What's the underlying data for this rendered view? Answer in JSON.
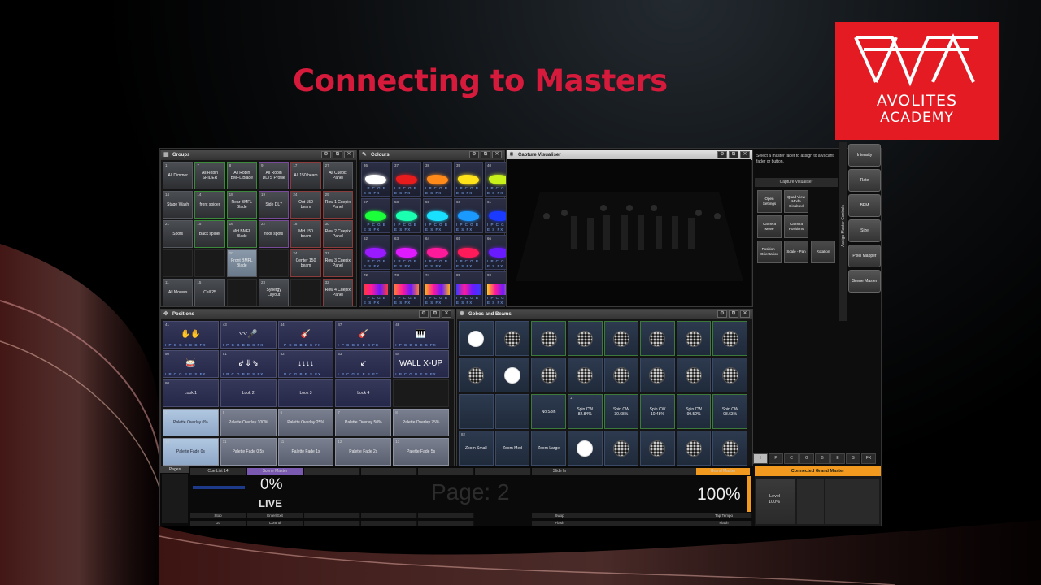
{
  "slide_title": "Connecting to Masters",
  "logo": {
    "line1": "AVOLITES",
    "line2": "ACADEMY",
    "bg_color": "#e51b24"
  },
  "windows": {
    "groups": {
      "title": "Groups",
      "tiles": [
        {
          "num": "1",
          "label": "All Dimmer",
          "cls": ""
        },
        {
          "num": "7",
          "label": "All Robin SPIDER",
          "cls": "g-green"
        },
        {
          "num": "8",
          "label": "All Robin BMFL Blade",
          "cls": "g-green"
        },
        {
          "num": "9",
          "label": "All Robin DL7S Profile",
          "cls": "g-purple"
        },
        {
          "num": "17",
          "label": "All 150 beam",
          "cls": "g-red"
        },
        {
          "num": "27",
          "label": "All Cuepix Panel",
          "cls": ""
        },
        {
          "num": "14",
          "label": "Stage Wash",
          "cls": ""
        },
        {
          "num": "14",
          "label": "front spider",
          "cls": "g-green"
        },
        {
          "num": "18",
          "label": "Rear BMFL Blade",
          "cls": "g-green"
        },
        {
          "num": "19",
          "label": "Side DL7",
          "cls": "g-purple"
        },
        {
          "num": "24",
          "label": "Out 150 beam",
          "cls": "g-red"
        },
        {
          "num": "29",
          "label": "Row 1 Cuepix Panel",
          "cls": "g-red"
        },
        {
          "num": "21",
          "label": "Spots",
          "cls": ""
        },
        {
          "num": "15",
          "label": "Back spider",
          "cls": "g-green"
        },
        {
          "num": "16",
          "label": "Mid BMFL Blade",
          "cls": "g-green"
        },
        {
          "num": "22",
          "label": "floor spots",
          "cls": "g-purple"
        },
        {
          "num": "18",
          "label": "Mid 150 beam",
          "cls": "g-red"
        },
        {
          "num": "30",
          "label": "Row 2 Cuepix Panel",
          "cls": "g-red"
        },
        {
          "num": "",
          "label": "",
          "cls": "empty"
        },
        {
          "num": "",
          "label": "",
          "cls": "empty"
        },
        {
          "num": "20",
          "label": "Front BMFL Blade",
          "cls": "sel"
        },
        {
          "num": "",
          "label": "",
          "cls": "empty"
        },
        {
          "num": "24",
          "label": "Center 150 beam",
          "cls": "g-red"
        },
        {
          "num": "31",
          "label": "Row 3 Cuepix Panel",
          "cls": "g-red"
        },
        {
          "num": "11",
          "label": "All Movers",
          "cls": ""
        },
        {
          "num": "15",
          "label": "Cell 25",
          "cls": ""
        },
        {
          "num": "",
          "label": "",
          "cls": "empty"
        },
        {
          "num": "23",
          "label": "Synergy Layout",
          "cls": ""
        },
        {
          "num": "",
          "label": "",
          "cls": "empty"
        },
        {
          "num": "32",
          "label": "Row 4 Cuepix Panel",
          "cls": "g-red"
        }
      ]
    },
    "colours": {
      "title": "Colours",
      "tiles": [
        {
          "num": "36",
          "color": "#ffffff"
        },
        {
          "num": "37",
          "color": "#e81c1c"
        },
        {
          "num": "38",
          "color": "#ff8a1a"
        },
        {
          "num": "39",
          "color": "#ffe21a"
        },
        {
          "num": "40",
          "color": "#c8f01a"
        },
        {
          "num": "57",
          "color": "#1aff3a"
        },
        {
          "num": "58",
          "color": "#1affb0"
        },
        {
          "num": "59",
          "color": "#1ae0ff"
        },
        {
          "num": "60",
          "color": "#1a9aff"
        },
        {
          "num": "61",
          "color": "#1a3aff"
        },
        {
          "num": "62",
          "color": "#9a1aff"
        },
        {
          "num": "63",
          "color": "#e01aff"
        },
        {
          "num": "64",
          "color": "#ff1a9a"
        },
        {
          "num": "65",
          "color": "#ff1a5a"
        },
        {
          "num": "66",
          "color": "#6a1aff"
        },
        {
          "num": "72",
          "color": "#ff3a3a"
        },
        {
          "num": "73",
          "color": "#ff7a3a"
        },
        {
          "num": "74",
          "color": "#ffae1a"
        },
        {
          "num": "89",
          "color": "#3a3aff"
        },
        {
          "num": "90",
          "color": "#ffce1a"
        }
      ]
    },
    "visualiser": {
      "title": "Capture Visualiser"
    },
    "positions": {
      "title": "Positions",
      "row_pics": [
        {
          "num": "41",
          "pic": "✋✋"
        },
        {
          "num": "43",
          "pic": "〰🎤"
        },
        {
          "num": "44",
          "pic": "🎸"
        },
        {
          "num": "47",
          "pic": "🎸"
        },
        {
          "num": "48",
          "pic": "🎹"
        },
        {
          "num": "50",
          "pic": "🥁"
        },
        {
          "num": "51",
          "pic": "⇙⇓⇘"
        },
        {
          "num": "52",
          "pic": "↓↓↓↓"
        },
        {
          "num": "53",
          "pic": "↙"
        },
        {
          "num": "54",
          "pic": "WALL X-UP"
        }
      ],
      "looks": [
        {
          "num": "80",
          "label": "Look 1"
        },
        {
          "num": "",
          "label": "Look 2"
        },
        {
          "num": "",
          "label": "Look 3"
        },
        {
          "num": "",
          "label": "Look 4"
        }
      ],
      "overlays": [
        {
          "num": "4",
          "label": "Palette Overlay 0%"
        },
        {
          "num": "5",
          "label": "Palette Overlay 100%"
        },
        {
          "num": "6",
          "label": "Palette Overlay 25%"
        },
        {
          "num": "7",
          "label": "Palette Overlay 50%"
        },
        {
          "num": "8",
          "label": "Palette Overlay 75%"
        }
      ],
      "fades": [
        {
          "num": "10",
          "label": "Palette Fade 0s"
        },
        {
          "num": "11",
          "label": "Palette Fade 0.5s"
        },
        {
          "num": "11",
          "label": "Palette Fade 1s"
        },
        {
          "num": "12",
          "label": "Palette Fade 2s"
        },
        {
          "num": "13",
          "label": "Palette Fade 5s"
        }
      ],
      "fx_bar": "I P C G B E S FX"
    },
    "gobos": {
      "title": "Gobos and Beams",
      "spin_row": [
        {
          "num": "",
          "label": ""
        },
        {
          "num": "",
          "label": ""
        },
        {
          "num": "",
          "label": "No Spin"
        },
        {
          "num": "17",
          "label": "Spin CW 82.84%"
        },
        {
          "num": "",
          "label": "Spin CW 30.68%"
        },
        {
          "num": "",
          "label": "Spin CW 10.48%"
        },
        {
          "num": "",
          "label": "Spin CW 99.52%"
        },
        {
          "num": "",
          "label": "Spin CW 98.63%"
        }
      ],
      "zoom_row": [
        {
          "num": "82",
          "label": "Zoom Small"
        },
        {
          "num": "",
          "label": "Zoom Med"
        },
        {
          "num": "",
          "label": "Zoom Large"
        }
      ]
    }
  },
  "sidebar": {
    "message": "Select a master fader to assign to a vacant fader or button.",
    "section_title": "Capture Visualiser",
    "buttons": [
      "Open Settings",
      "Quad View Mode Disabled",
      "Camera Move",
      "Camera Positions",
      "Position - Orientation",
      "Scale - Pan",
      "Rotation"
    ],
    "vertical_label": "Assign Master Controls",
    "right_buttons": [
      "Intensity",
      "Rate",
      "BPM",
      "Size",
      "Pixel Mapper",
      "Scene Master"
    ],
    "key_tabs": [
      "I",
      "P",
      "C",
      "G",
      "B",
      "E",
      "S",
      "FX"
    ]
  },
  "playbacks": {
    "pages_label": "Pages",
    "headers": [
      "Cue List 14",
      "Scene Master",
      "",
      "",
      "",
      "",
      "Slide In",
      "",
      "",
      "Grand Master"
    ],
    "scene_value": "0%",
    "live_label": "LIVE",
    "page_text": "Page: 2",
    "grand_value": "100%",
    "foot1": [
      "Stop",
      "Enter/Exit",
      "",
      "",
      "",
      "Swop",
      "",
      "",
      "Tap Tempo"
    ],
    "foot2": [
      "Go",
      "Control",
      "",
      "",
      "",
      "Flash",
      "",
      "",
      "Flash"
    ],
    "connected_master": "Connected Grand Master",
    "level_label": "Level",
    "level_value": "100%"
  }
}
